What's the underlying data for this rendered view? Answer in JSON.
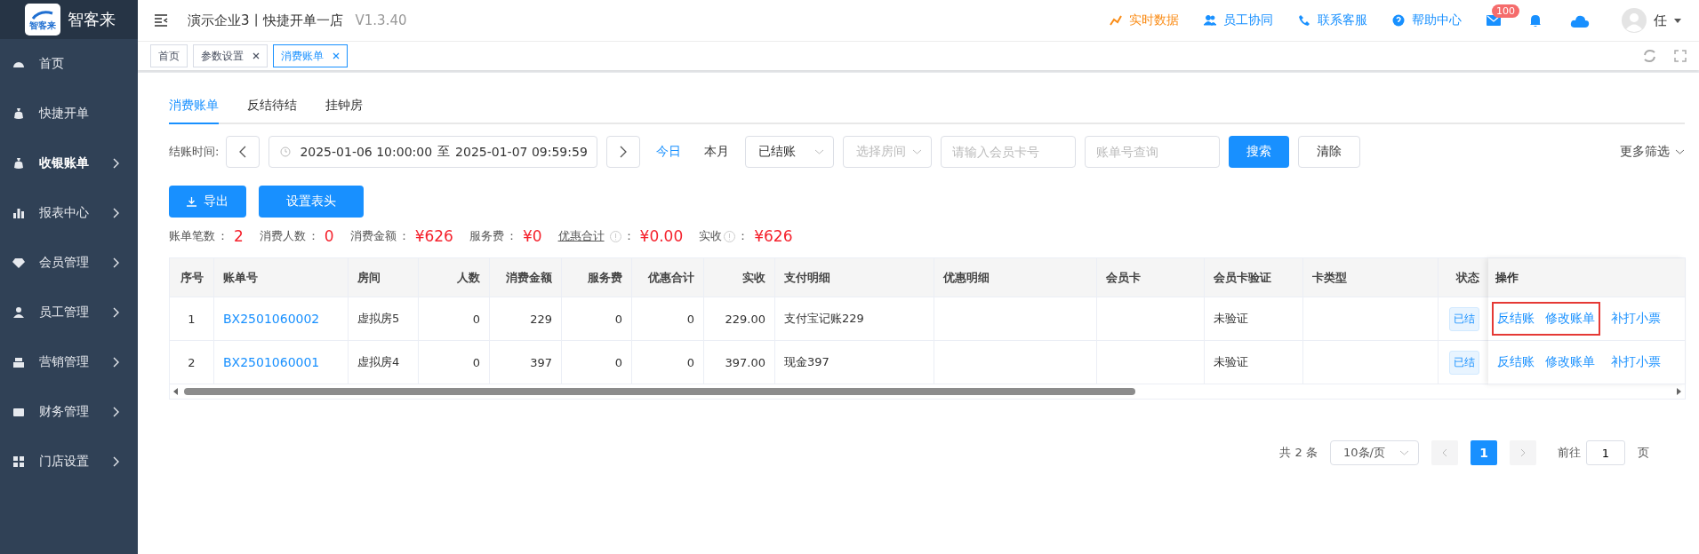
{
  "logo": {
    "badge": "智客来",
    "name": "智客来"
  },
  "sidebar": {
    "items": [
      {
        "label": "首页",
        "has_children": false,
        "selected": false
      },
      {
        "label": "快捷开单",
        "has_children": false,
        "selected": false
      },
      {
        "label": "收银账单",
        "has_children": true,
        "selected": true
      },
      {
        "label": "报表中心",
        "has_children": true,
        "selected": false
      },
      {
        "label": "会员管理",
        "has_children": true,
        "selected": false
      },
      {
        "label": "员工管理",
        "has_children": true,
        "selected": false
      },
      {
        "label": "营销管理",
        "has_children": true,
        "selected": false
      },
      {
        "label": "财务管理",
        "has_children": true,
        "selected": false
      },
      {
        "label": "门店设置",
        "has_children": true,
        "selected": false
      }
    ]
  },
  "header": {
    "title": "演示企业3丨快捷开单一店",
    "version": "V1.3.40",
    "links": [
      {
        "label": "实时数据",
        "color": "#fa8c16"
      },
      {
        "label": "员工协同",
        "color": "#1890ff"
      },
      {
        "label": "联系客服",
        "color": "#1890ff"
      },
      {
        "label": "帮助中心",
        "color": "#1890ff"
      }
    ],
    "mail_badge": "100",
    "user": "任"
  },
  "open_tabs": [
    {
      "label": "首页",
      "closable": false,
      "selected": false
    },
    {
      "label": "参数设置",
      "closable": true,
      "selected": false
    },
    {
      "label": "消费账单",
      "closable": true,
      "selected": true
    }
  ],
  "page_tabs": [
    {
      "label": "消费账单",
      "selected": true
    },
    {
      "label": "反结待结",
      "selected": false
    },
    {
      "label": "挂钟房",
      "selected": false
    }
  ],
  "filters": {
    "time_label": "结账时间:",
    "start": "2025-01-06 10:00:00",
    "separator": "至",
    "end": "2025-01-07 09:59:59",
    "quick": [
      {
        "label": "今日",
        "selected": true
      },
      {
        "label": "本月",
        "selected": false
      }
    ],
    "selects": [
      {
        "value": "已结账"
      },
      {
        "placeholder": "选择房间"
      }
    ],
    "inputs": [
      {
        "placeholder": "请输入会员卡号"
      },
      {
        "placeholder": "账单号查询"
      }
    ],
    "search": "搜索",
    "clear": "清除",
    "more": "更多筛选"
  },
  "actions": {
    "export": "导出",
    "columns": "设置表头"
  },
  "stats": [
    {
      "label": "账单笔数",
      "value": "2",
      "underlined": false,
      "info": false,
      "colon": "："
    },
    {
      "label": "消费人数",
      "value": "0",
      "underlined": false,
      "info": false,
      "colon": "："
    },
    {
      "label": "消费金额",
      "value": "¥626",
      "underlined": false,
      "info": false,
      "colon": "："
    },
    {
      "label": "服务费",
      "value": "¥0",
      "underlined": false,
      "info": false,
      "colon": "："
    },
    {
      "label": "优惠合计",
      "value": "¥0.00",
      "underlined": true,
      "info": true,
      "colon": "："
    },
    {
      "label": "实收",
      "value": "¥626",
      "underlined": false,
      "info": true,
      "colon": "："
    }
  ],
  "table": {
    "columns": [
      {
        "label": "序号",
        "kind": "index"
      },
      {
        "label": "账单号",
        "kind": "link"
      },
      {
        "label": "房间",
        "kind": "text"
      },
      {
        "label": "人数",
        "kind": "number"
      },
      {
        "label": "消费金额",
        "kind": "number"
      },
      {
        "label": "服务费",
        "kind": "number"
      },
      {
        "label": "优惠合计",
        "kind": "number"
      },
      {
        "label": "实收",
        "kind": "number"
      },
      {
        "label": "支付明细",
        "kind": "text"
      },
      {
        "label": "优惠明细",
        "kind": "text"
      },
      {
        "label": "会员卡",
        "kind": "text"
      },
      {
        "label": "会员卡验证",
        "kind": "text"
      },
      {
        "label": "卡类型",
        "kind": "text"
      },
      {
        "label": "状态",
        "kind": "tag"
      }
    ],
    "actions_label": "操作",
    "rows": [
      {
        "cells": [
          "1",
          "BX2501060002",
          "虚拟房5",
          "0",
          "229",
          "0",
          "0",
          "229.00",
          "支付宝记账229",
          "",
          "",
          "未验证",
          "",
          "已结"
        ],
        "actions": [
          "反结账",
          "修改账单",
          "补打小票"
        ],
        "highlighted": true
      },
      {
        "cells": [
          "2",
          "BX2501060001",
          "虚拟房4",
          "0",
          "397",
          "0",
          "0",
          "397.00",
          "现金397",
          "",
          "",
          "未验证",
          "",
          "已结"
        ],
        "actions": [
          "反结账",
          "修改账单",
          "补打小票"
        ],
        "highlighted": false
      }
    ]
  },
  "pagination": {
    "total": "共 2 条",
    "page_size": "10条/页",
    "pages": [
      {
        "label": "1",
        "selected": true
      }
    ],
    "goto_label": "前往",
    "goto_value": "1",
    "page_suffix": "页"
  }
}
